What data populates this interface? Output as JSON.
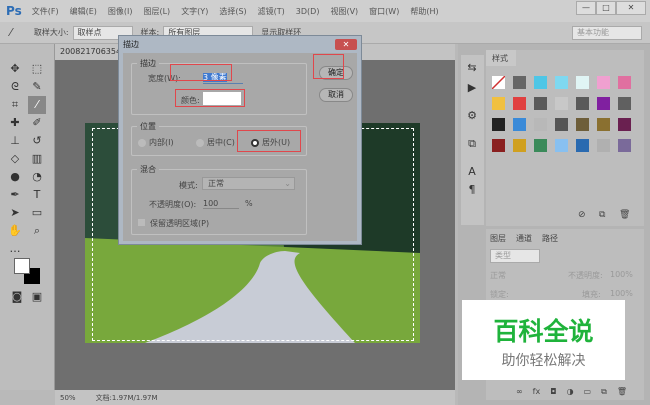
{
  "app": {
    "logo": "Ps",
    "menus": [
      "文件(F)",
      "编辑(E)",
      "图像(I)",
      "图层(L)",
      "文字(Y)",
      "选择(S)",
      "滤镜(T)",
      "3D(D)",
      "视图(V)",
      "窗口(W)",
      "帮助(H)"
    ],
    "window_controls": [
      "—",
      "□",
      "✕"
    ]
  },
  "options": {
    "sample_size_label": "取样大小:",
    "sample_size_value": "取样点",
    "sample_label": "样本:",
    "sample_value": "所有图层",
    "show_ring": "显示取样环",
    "workspace": "基本功能"
  },
  "document": {
    "tab": "200821706354",
    "zoom": "50%",
    "doc_info": "文档:1.97M/1.97M"
  },
  "dialog": {
    "title": "描边",
    "close": "✕",
    "stroke_group": "描边",
    "width_label": "宽度(W):",
    "width_value": "3 像素",
    "color_label": "颜色:",
    "color_value": "#ffffff",
    "position_group": "位置",
    "inside": "内部(I)",
    "center": "居中(C)",
    "outside": "居外(U)",
    "selected_position": "outside",
    "blend_group": "混合",
    "mode_label": "模式:",
    "mode_value": "正常",
    "opacity_label": "不透明度(O):",
    "opacity_value": "100",
    "opacity_unit": "%",
    "preserve_label": "保留透明区域(P)",
    "ok": "确定",
    "cancel": "取消"
  },
  "styles_panel": {
    "tab": "样式",
    "swatches": [
      "#ffffff",
      "#666666",
      "#4fc6e6",
      "#7fd8f0",
      "#e0f4f4",
      "#f0a0d0",
      "#e070a0",
      "#f0c040",
      "#e04040",
      "#5a5a5a",
      "#c8c8c8",
      "#5a5a5a",
      "#8020a0",
      "#606060",
      "#222222",
      "#3a8ad8",
      "#b8b8b8",
      "#555555",
      "#6e5e3a",
      "#8a7030",
      "#6a2050",
      "#8a2020",
      "#d0a020",
      "#3a8a5a",
      "#88c0f0",
      "#2a6ab0",
      "#b0b0b0",
      "#7a6a9a"
    ]
  },
  "layers_panel": {
    "tabs": [
      "图层",
      "通道",
      "路径"
    ],
    "filter": "类型",
    "blend": "正常",
    "opacity_label": "不透明度:",
    "opacity": "100%",
    "lock_label": "锁定:",
    "fill_label": "填充:",
    "fill": "100%"
  },
  "watermark": {
    "title": "百科全说",
    "subtitle": "助你轻松解决"
  }
}
